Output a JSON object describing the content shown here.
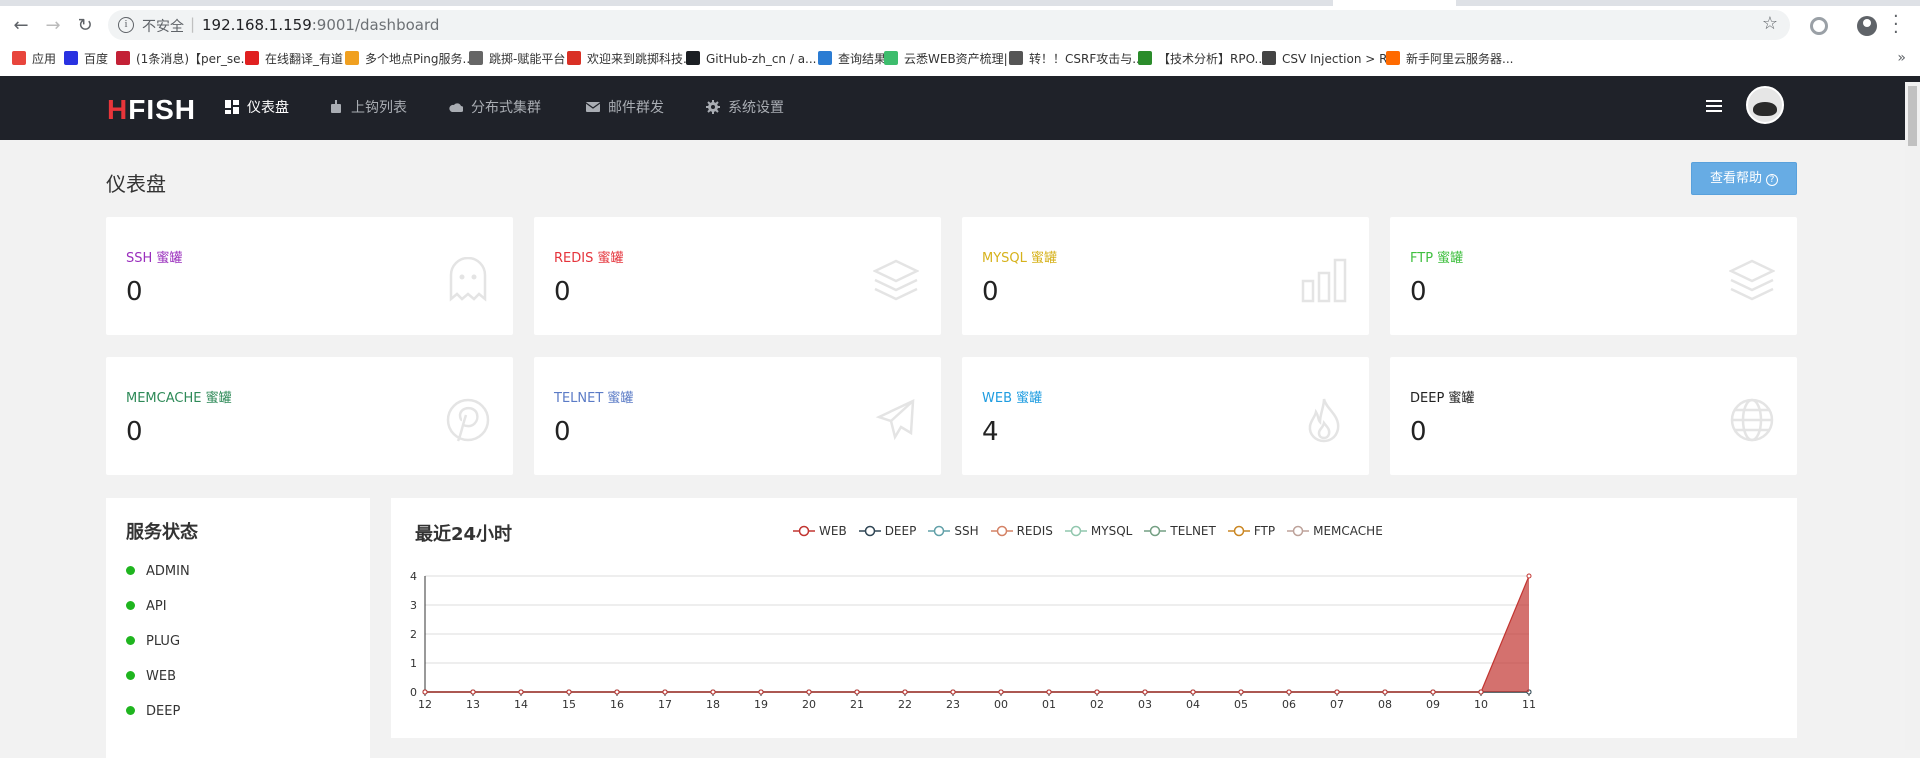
{
  "browser": {
    "insecure_label": "不安全",
    "url_host": "192.168.1.159",
    "url_rest": ":9001/dashboard",
    "bookmarks": [
      {
        "label": "应用",
        "icon": "apps-grid-icon",
        "color": "#e8453c"
      },
      {
        "label": "百度",
        "icon": "baidu-paw-icon",
        "color": "#2932e1"
      },
      {
        "label": "(1条消息)【per_se...",
        "icon": "csdn-c-icon",
        "color": "#c32136"
      },
      {
        "label": "在线翻译_有道",
        "icon": "youdao-y-icon",
        "color": "#e02020"
      },
      {
        "label": "多个地点Ping服务...",
        "icon": "chinaz-icon",
        "color": "#f0a020"
      },
      {
        "label": "跳掷-赋能平台",
        "icon": "shield-v-icon",
        "color": "#666666"
      },
      {
        "label": "欢迎来到跳掷科技...",
        "icon": "gmail-m-icon",
        "color": "#d93025"
      },
      {
        "label": "GitHub-zh_cn / a...",
        "icon": "github-icon",
        "color": "#1b1f23"
      },
      {
        "label": "查询结果",
        "icon": "x-box-icon",
        "color": "#2b7cd3"
      },
      {
        "label": "云悉WEB资产梳理|...",
        "icon": "yunxi-icon",
        "color": "#3dbd6d"
      },
      {
        "label": "转！！CSRF攻击与...",
        "icon": "dragon-icon",
        "color": "#555555"
      },
      {
        "label": "【技术分析】RPO...",
        "icon": "star-icon",
        "color": "#2b8c2b"
      },
      {
        "label": "CSV Injection > R...",
        "icon": "globe-icon",
        "color": "#444444"
      },
      {
        "label": "新手阿里云服务器...",
        "icon": "aliyun-icon",
        "color": "#ff6a00"
      }
    ]
  },
  "app": {
    "logo_h": "H",
    "logo_rest": "FISH",
    "nav": [
      {
        "label": "仪表盘",
        "icon": "dashboard-icon",
        "active": true
      },
      {
        "label": "上钩列表",
        "icon": "robot-icon",
        "active": false
      },
      {
        "label": "分布式集群",
        "icon": "cloud-icon",
        "active": false
      },
      {
        "label": "邮件群发",
        "icon": "mail-icon",
        "active": false
      },
      {
        "label": "系统设置",
        "icon": "gear-icon",
        "active": false
      }
    ]
  },
  "page": {
    "title": "仪表盘",
    "help_button": "查看帮助"
  },
  "cards": [
    {
      "label": "SSH 蜜罐",
      "value": "0",
      "color": "#9a2fbd",
      "icon": "ghost-icon"
    },
    {
      "label": "REDIS 蜜罐",
      "value": "0",
      "color": "#e5343c",
      "icon": "layers-icon"
    },
    {
      "label": "MYSQL 蜜罐",
      "value": "0",
      "color": "#d6b21c",
      "icon": "bar-chart-icon"
    },
    {
      "label": "FTP 蜜罐",
      "value": "0",
      "color": "#3fbf3f",
      "icon": "layers-icon"
    },
    {
      "label": "MEMCACHE 蜜罐",
      "value": "0",
      "color": "#2e8a58",
      "icon": "pinterest-icon"
    },
    {
      "label": "TELNET 蜜罐",
      "value": "0",
      "color": "#5b7bc6",
      "icon": "plane-icon"
    },
    {
      "label": "WEB 蜜罐",
      "value": "4",
      "color": "#1e9ce0",
      "icon": "fire-icon"
    },
    {
      "label": "DEEP 蜜罐",
      "value": "0",
      "color": "#222222",
      "icon": "globe-icon"
    }
  ],
  "services": {
    "title": "服务状态",
    "items": [
      "ADMIN",
      "API",
      "PLUG",
      "WEB",
      "DEEP"
    ],
    "status_color": "#1fb51f"
  },
  "chart": {
    "title": "最近24小时"
  },
  "chart_data": {
    "type": "area",
    "x": [
      "12",
      "13",
      "14",
      "15",
      "16",
      "17",
      "18",
      "19",
      "20",
      "21",
      "22",
      "23",
      "00",
      "01",
      "02",
      "03",
      "04",
      "05",
      "06",
      "07",
      "08",
      "09",
      "10",
      "11"
    ],
    "ylim": [
      0,
      4
    ],
    "yticks": [
      0,
      1,
      2,
      3,
      4
    ],
    "grid": true,
    "legend_position": "top-center",
    "series": [
      {
        "name": "WEB",
        "color": "#c23531",
        "values": [
          0,
          0,
          0,
          0,
          0,
          0,
          0,
          0,
          0,
          0,
          0,
          0,
          0,
          0,
          0,
          0,
          0,
          0,
          0,
          0,
          0,
          0,
          0,
          4
        ]
      },
      {
        "name": "DEEP",
        "color": "#2f4554",
        "values": [
          0,
          0,
          0,
          0,
          0,
          0,
          0,
          0,
          0,
          0,
          0,
          0,
          0,
          0,
          0,
          0,
          0,
          0,
          0,
          0,
          0,
          0,
          0,
          0
        ]
      },
      {
        "name": "SSH",
        "color": "#61a0a8",
        "values": [
          0,
          0,
          0,
          0,
          0,
          0,
          0,
          0,
          0,
          0,
          0,
          0,
          0,
          0,
          0,
          0,
          0,
          0,
          0,
          0,
          0,
          0,
          0,
          0
        ]
      },
      {
        "name": "REDIS",
        "color": "#d48265",
        "values": [
          0,
          0,
          0,
          0,
          0,
          0,
          0,
          0,
          0,
          0,
          0,
          0,
          0,
          0,
          0,
          0,
          0,
          0,
          0,
          0,
          0,
          0,
          0,
          0
        ]
      },
      {
        "name": "MYSQL",
        "color": "#91c7ae",
        "values": [
          0,
          0,
          0,
          0,
          0,
          0,
          0,
          0,
          0,
          0,
          0,
          0,
          0,
          0,
          0,
          0,
          0,
          0,
          0,
          0,
          0,
          0,
          0,
          0
        ]
      },
      {
        "name": "TELNET",
        "color": "#749f83",
        "values": [
          0,
          0,
          0,
          0,
          0,
          0,
          0,
          0,
          0,
          0,
          0,
          0,
          0,
          0,
          0,
          0,
          0,
          0,
          0,
          0,
          0,
          0,
          0,
          0
        ]
      },
      {
        "name": "FTP",
        "color": "#ca8622",
        "values": [
          0,
          0,
          0,
          0,
          0,
          0,
          0,
          0,
          0,
          0,
          0,
          0,
          0,
          0,
          0,
          0,
          0,
          0,
          0,
          0,
          0,
          0,
          0,
          0
        ]
      },
      {
        "name": "MEMCACHE",
        "color": "#bda29a",
        "values": [
          0,
          0,
          0,
          0,
          0,
          0,
          0,
          0,
          0,
          0,
          0,
          0,
          0,
          0,
          0,
          0,
          0,
          0,
          0,
          0,
          0,
          0,
          0,
          0
        ]
      }
    ]
  }
}
